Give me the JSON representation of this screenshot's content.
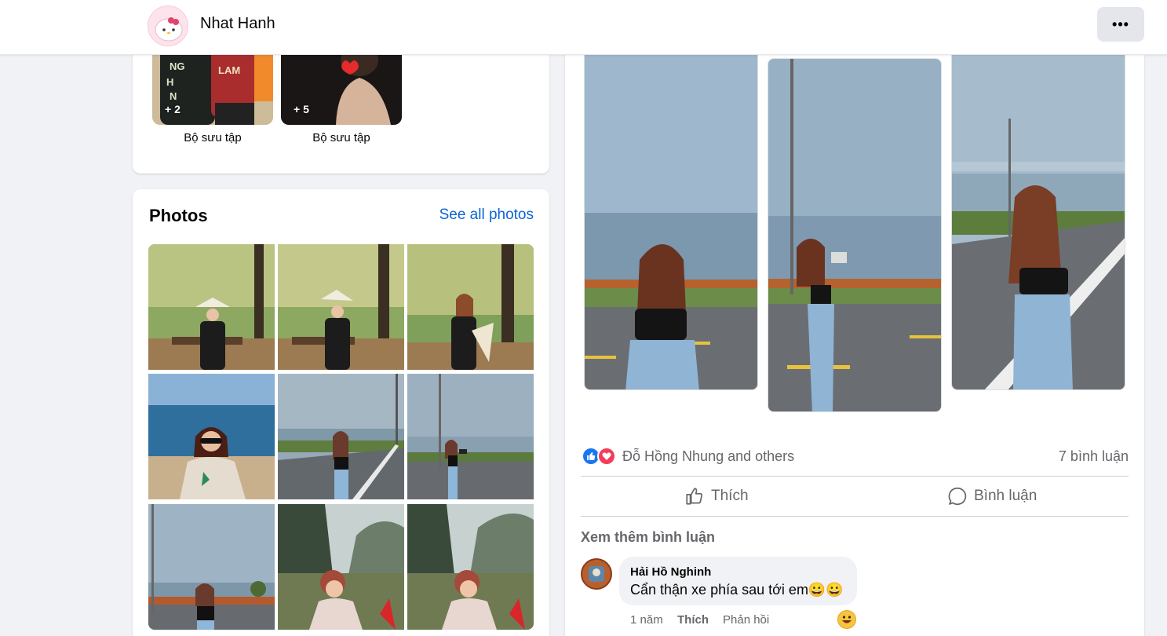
{
  "header": {
    "profile_name": "Nhat Hanh",
    "more_label": "•••"
  },
  "collections": {
    "items": [
      {
        "label": "Bộ sưu tập",
        "count_badge": "+ 2",
        "overlay_text": "NGƯỜI HƯƠNG NỘI"
      },
      {
        "label": "Bộ sưu tập",
        "count_badge": "+ 5"
      }
    ]
  },
  "photos": {
    "title": "Photos",
    "see_all": "See all photos"
  },
  "post": {
    "reactions": {
      "names": "Đỗ Hồng Nhung and others",
      "comment_count": "7 bình luận"
    },
    "actions": {
      "like": "Thích",
      "comment": "Bình luận"
    },
    "more_comments": "Xem thêm bình luận",
    "comment": {
      "author": "Hải Hồ Nghinh",
      "text": "Cẩn thận xe phía sau tới em😀😀",
      "time": "1 năm",
      "like": "Thích",
      "reply": "Phản hồi"
    }
  },
  "colors": {
    "accent": "#0a66d2",
    "like_blue": "#1877f2",
    "love_red": "#f33e58",
    "page_bg": "#f0f2f5"
  }
}
